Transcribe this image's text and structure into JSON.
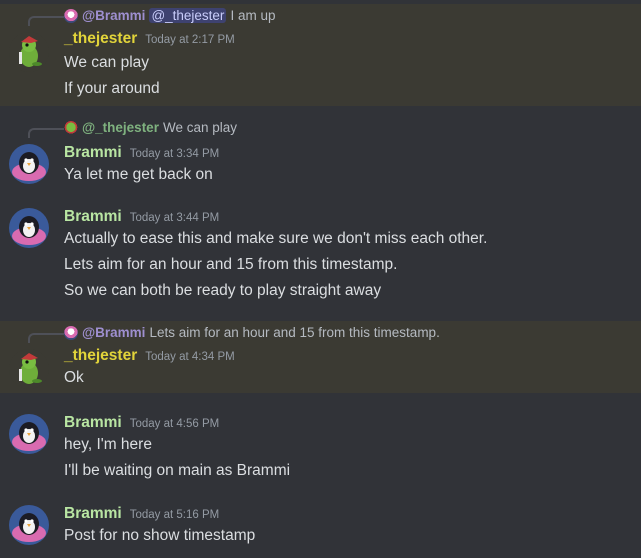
{
  "colors": {
    "background": "#313338",
    "mention_highlight": "#3b3a33",
    "jester_name": "#e2d43a",
    "brammi_name": "#b9e6a3",
    "timestamp": "#949ba4",
    "text": "#dbdee1"
  },
  "messages": [
    {
      "reply": {
        "name": "@Brammi",
        "mention": "@_thejester",
        "text": "I am up"
      },
      "author": "_thejester",
      "timestamp": "Today at 2:17 PM",
      "lines": [
        "We can play",
        "If your around"
      ]
    },
    {
      "reply": {
        "name": "@_thejester",
        "text": "We can play"
      },
      "author": "Brammi",
      "timestamp": "Today at 3:34 PM",
      "lines": [
        "Ya let me get back on"
      ]
    },
    {
      "author": "Brammi",
      "timestamp": "Today at 3:44 PM",
      "lines": [
        "Actually to ease this and make sure we don't miss each other.",
        "Lets aim for an hour and 15 from this timestamp.",
        "So we can both be ready to play straight away"
      ]
    },
    {
      "reply": {
        "name": "@Brammi",
        "text": "Lets aim for an hour and 15 from this timestamp."
      },
      "author": "_thejester",
      "timestamp": "Today at 4:34 PM",
      "lines": [
        "Ok"
      ]
    },
    {
      "author": "Brammi",
      "timestamp": "Today at 4:56 PM",
      "lines": [
        "hey, I'm here",
        "I'll be waiting on main as Brammi"
      ]
    },
    {
      "author": "Brammi",
      "timestamp": "Today at 5:16 PM",
      "lines": [
        "Post for no show timestamp"
      ]
    }
  ]
}
